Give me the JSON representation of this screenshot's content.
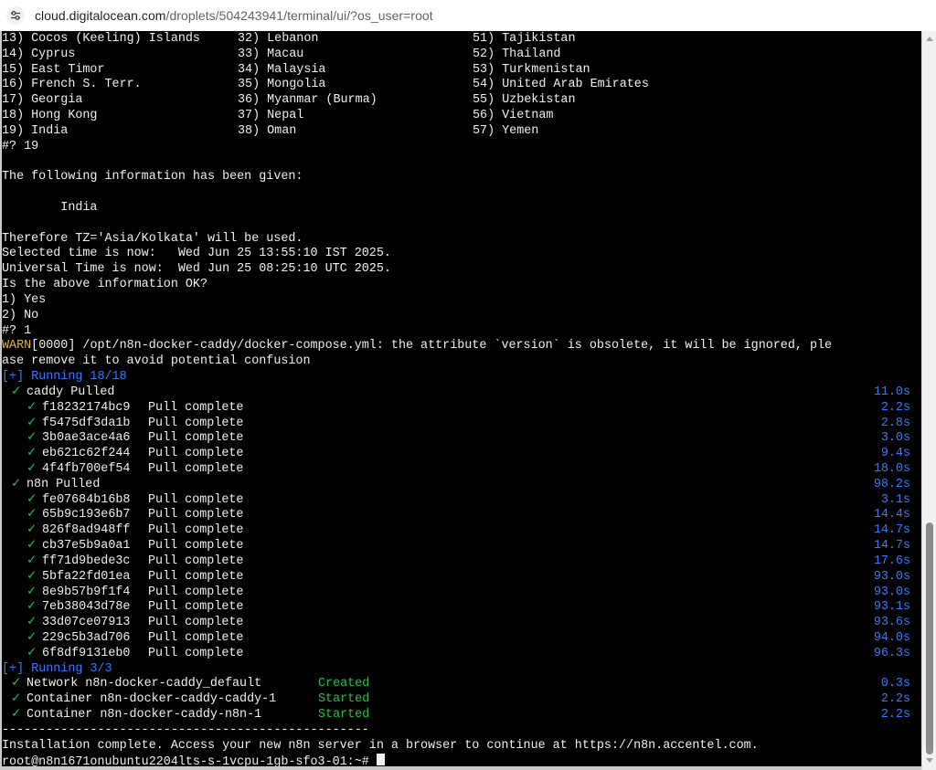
{
  "browser": {
    "url_host": "cloud.digitalocean.com",
    "url_path": "/droplets/504243941/terminal/ui/?os_user=root",
    "site_info_icon": "tune-icon"
  },
  "terminal": {
    "colors": {
      "background": "#000000",
      "text": "#f0f0f0",
      "blue": "#3b78ff",
      "green": "#2fbf3f",
      "warn": "#e0b341"
    },
    "timezone_rows": [
      {
        "a": "13) Cocos (Keeling) Islands",
        "b": "32) Lebanon",
        "c": "51) Tajikistan"
      },
      {
        "a": "14) Cyprus",
        "b": "33) Macau",
        "c": "52) Thailand"
      },
      {
        "a": "15) East Timor",
        "b": "34) Malaysia",
        "c": "53) Turkmenistan"
      },
      {
        "a": "16) French S. Terr.",
        "b": "35) Mongolia",
        "c": "54) United Arab Emirates"
      },
      {
        "a": "17) Georgia",
        "b": "36) Myanmar (Burma)",
        "c": "55) Uzbekistan"
      },
      {
        "a": "18) Hong Kong",
        "b": "37) Nepal",
        "c": "56) Vietnam"
      },
      {
        "a": "19) India",
        "b": "38) Oman",
        "c": "57) Yemen"
      }
    ],
    "prompt_tz": "#? 19",
    "info_given": "The following information has been given:",
    "country": "        India",
    "therefore": "Therefore TZ='Asia/Kolkata' will be used.",
    "selected_time": "Selected time is now:   Wed Jun 25 13:55:10 IST 2025.",
    "universal_time": "Universal Time is now:  Wed Jun 25 08:25:10 UTC 2025.",
    "question": "Is the above information OK?",
    "opt_yes": "1) Yes",
    "opt_no": "2) No",
    "prompt_ok": "#? 1",
    "warn_tag": "WARN",
    "warn_msg": "[0000] /opt/n8n-docker-caddy/docker-compose.yml: the attribute `version` is obsolete, it will be ignored, ple",
    "warn_msg2": "ase remove it to avoid potential confusion",
    "running_1": "[+] Running 18/18",
    "check": "✓",
    "caddy": {
      "label": "caddy Pulled",
      "time": "11.0s"
    },
    "caddy_layers": [
      {
        "id": "f18232174bc9",
        "status": "Pull complete",
        "time": "2.2s"
      },
      {
        "id": "f5475df3da1b",
        "status": "Pull complete",
        "time": "2.8s"
      },
      {
        "id": "3b0ae3ace4a6",
        "status": "Pull complete",
        "time": "3.0s"
      },
      {
        "id": "eb621c62f244",
        "status": "Pull complete",
        "time": "9.4s"
      },
      {
        "id": "4f4fb700ef54",
        "status": "Pull complete",
        "time": "18.0s"
      }
    ],
    "n8n": {
      "label": "n8n Pulled",
      "time": "98.2s"
    },
    "n8n_layers": [
      {
        "id": "fe07684b16b8",
        "status": "Pull complete",
        "time": "3.1s"
      },
      {
        "id": "65b9c193e6b7",
        "status": "Pull complete",
        "time": "14.4s"
      },
      {
        "id": "826f8ad948ff",
        "status": "Pull complete",
        "time": "14.7s"
      },
      {
        "id": "cb37e5b9a0a1",
        "status": "Pull complete",
        "time": "14.7s"
      },
      {
        "id": "ff71d9bede3c",
        "status": "Pull complete",
        "time": "17.6s"
      },
      {
        "id": "5bfa22fd01ea",
        "status": "Pull complete",
        "time": "93.0s"
      },
      {
        "id": "8e9b57b9f1f4",
        "status": "Pull complete",
        "time": "93.0s"
      },
      {
        "id": "7eb38043d78e",
        "status": "Pull complete",
        "time": "93.1s"
      },
      {
        "id": "33d07ce07913",
        "status": "Pull complete",
        "time": "93.6s"
      },
      {
        "id": "229c5b3ad706",
        "status": "Pull complete",
        "time": "94.0s"
      },
      {
        "id": "6f8df9131eb0",
        "status": "Pull complete",
        "time": "96.3s"
      }
    ],
    "running_2": "[+] Running 3/3",
    "resources": [
      {
        "name": "Network n8n-docker-caddy_default",
        "state": "Created",
        "time": "0.3s"
      },
      {
        "name": "Container n8n-docker-caddy-caddy-1",
        "state": "Started",
        "time": "2.2s"
      },
      {
        "name": "Container n8n-docker-caddy-n8n-1",
        "state": "Started",
        "time": "2.2s"
      }
    ],
    "separator": "--------------------------------------------------",
    "install_complete": "Installation complete. Access your new n8n server in a browser to continue at https://n8n.accentel.com.",
    "shell_prompt": "root@n8n1671onubuntu2204lts-s-1vcpu-1gb-sfo3-01:~# "
  }
}
